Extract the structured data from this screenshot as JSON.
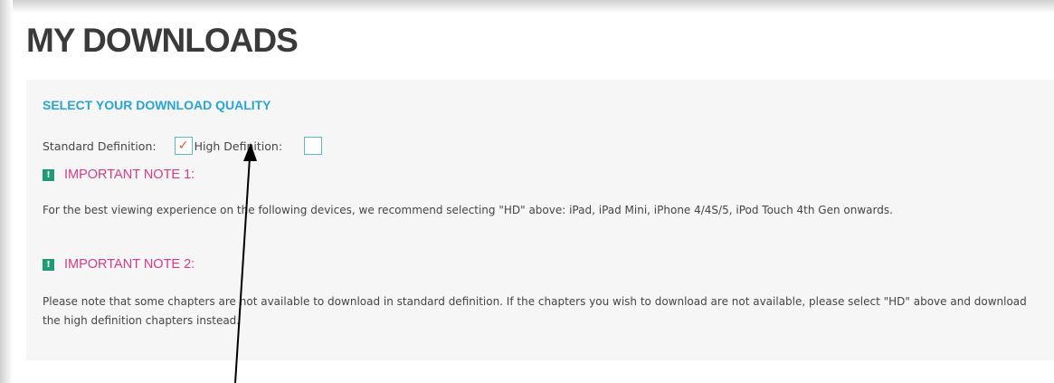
{
  "page": {
    "title": "MY DOWNLOADS"
  },
  "quality": {
    "heading": "SELECT YOUR DOWNLOAD QUALITY",
    "options": [
      {
        "label": "Standard Definition:",
        "checked": true,
        "check_mark": "✓"
      },
      {
        "label": "High Definition:",
        "checked": false,
        "check_mark": ""
      }
    ]
  },
  "notes": [
    {
      "icon": "!",
      "heading": "IMPORTANT NOTE 1:",
      "body": "For the best viewing experience on the following devices, we recommend selecting \"HD\" above: iPad, iPad Mini, iPhone 4/4S/5, iPod Touch 4th Gen onwards."
    },
    {
      "icon": "!",
      "heading": "IMPORTANT NOTE 2:",
      "body": "Please note that some chapters are not available to download in standard definition. If the chapters you wish to download are not available, please select \"HD\" above and download the high definition chapters instead."
    }
  ],
  "colors": {
    "heading_blue": "#29a3d6",
    "note_pink": "#d53b86",
    "note_icon_green": "#1f9c76",
    "check_orange": "#e2582e",
    "checkbox_border": "#5bb9c7",
    "panel_bg": "#f6f6f6"
  },
  "annotation": {
    "type": "arrow",
    "color": "#000000",
    "points_to": "High Definition:"
  }
}
